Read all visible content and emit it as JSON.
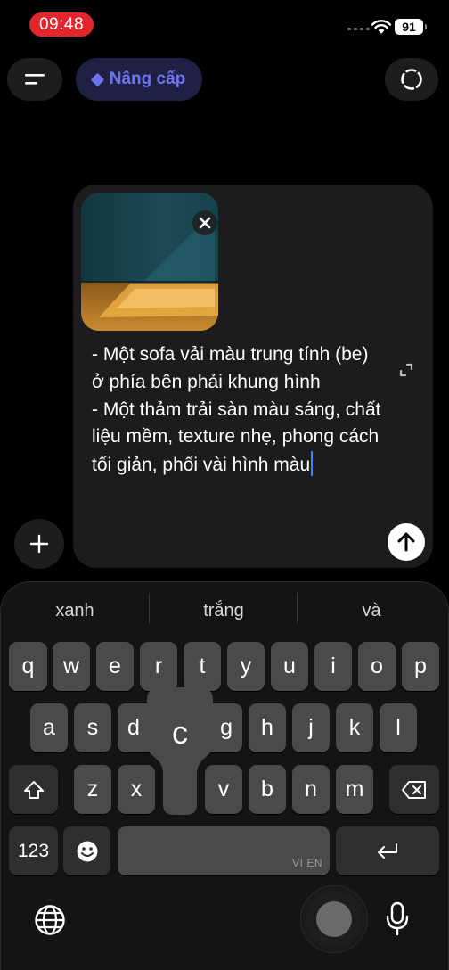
{
  "status_bar": {
    "time": "09:48",
    "battery": "91"
  },
  "top_bar": {
    "upgrade_label": "Nâng cấp"
  },
  "composer": {
    "text": "- Một sofa vải màu trung tính (be) ở phía bên phải khung hình\n- Một thảm trải sàn màu sáng, chất liệu mềm, texture nhẹ, phong cách tối giản, phối vài hình màu"
  },
  "keyboard": {
    "suggestions": [
      "xanh",
      "trắng",
      "và"
    ],
    "row1": [
      "q",
      "w",
      "e",
      "r",
      "t",
      "y",
      "u",
      "i",
      "o",
      "p"
    ],
    "row2": [
      "a",
      "s",
      "d",
      "f",
      "g",
      "h",
      "j",
      "k",
      "l"
    ],
    "row3": [
      "z",
      "x",
      "c",
      "v",
      "b",
      "n",
      "m"
    ],
    "popup_key": "c",
    "numbers_label": "123",
    "space_lang_label": "VI EN",
    "icons": [
      "shift-icon",
      "backspace-icon",
      "emoji-icon",
      "return-icon",
      "globe-icon",
      "dictation-icon"
    ]
  },
  "colors": {
    "accent_upgrade": "#6f73f0",
    "time_pill": "#e3262c",
    "caret": "#3a82f7"
  }
}
